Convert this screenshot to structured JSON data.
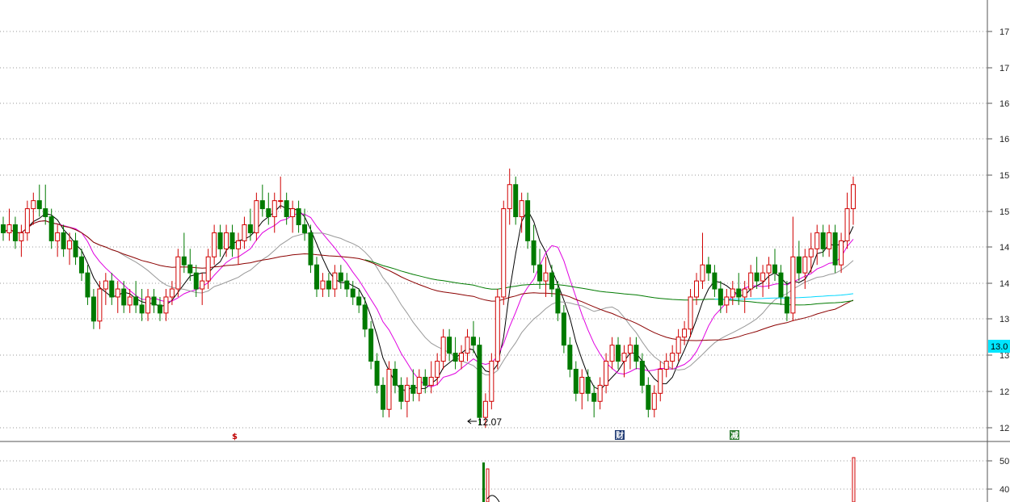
{
  "chart_data": {
    "type": "candlestick",
    "price_axis": {
      "tick_labels": [
        "17",
        "17",
        "16",
        "16",
        "15",
        "15",
        "14",
        "14",
        "13",
        "13",
        "12",
        "12"
      ],
      "ylim": [
        11.9,
        17.4
      ],
      "grid": "dotted horizontal"
    },
    "current_price_tag": "13.0",
    "low_annotation": "12.07",
    "volume_axis": {
      "tick_labels": [
        "50",
        "40"
      ]
    },
    "event_markers": [
      {
        "label": "$",
        "color": "#c00000"
      },
      {
        "label": "财",
        "color": "#1f3a73"
      },
      {
        "label": "减",
        "color": "#2e7d32"
      }
    ],
    "candles": [
      [
        14.6,
        14.7,
        14.4,
        14.5
      ],
      [
        14.5,
        14.8,
        14.4,
        14.6
      ],
      [
        14.6,
        14.7,
        14.3,
        14.4
      ],
      [
        14.4,
        14.6,
        14.2,
        14.5
      ],
      [
        14.5,
        14.9,
        14.4,
        14.8
      ],
      [
        14.8,
        15.0,
        14.6,
        14.9
      ],
      [
        14.9,
        15.1,
        14.7,
        14.8
      ],
      [
        14.8,
        15.1,
        14.6,
        14.7
      ],
      [
        14.7,
        14.8,
        14.3,
        14.4
      ],
      [
        14.4,
        14.6,
        14.2,
        14.5
      ],
      [
        14.5,
        14.6,
        14.2,
        14.3
      ],
      [
        14.3,
        14.5,
        14.1,
        14.4
      ],
      [
        14.4,
        14.5,
        14.1,
        14.2
      ],
      [
        14.2,
        14.3,
        13.9,
        14.0
      ],
      [
        14.0,
        14.1,
        13.6,
        13.7
      ],
      [
        13.7,
        13.8,
        13.3,
        13.4
      ],
      [
        13.4,
        13.9,
        13.3,
        13.8
      ],
      [
        13.8,
        14.0,
        13.6,
        13.9
      ],
      [
        13.9,
        14.0,
        13.6,
        13.7
      ],
      [
        13.7,
        13.9,
        13.5,
        13.8
      ],
      [
        13.8,
        13.9,
        13.5,
        13.6
      ],
      [
        13.6,
        13.8,
        13.5,
        13.7
      ],
      [
        13.7,
        13.9,
        13.5,
        13.6
      ],
      [
        13.6,
        13.8,
        13.4,
        13.5
      ],
      [
        13.5,
        13.8,
        13.4,
        13.7
      ],
      [
        13.7,
        13.8,
        13.5,
        13.6
      ],
      [
        13.6,
        13.7,
        13.4,
        13.5
      ],
      [
        13.5,
        13.8,
        13.4,
        13.7
      ],
      [
        13.7,
        13.9,
        13.6,
        13.8
      ],
      [
        13.8,
        14.3,
        13.7,
        14.2
      ],
      [
        14.2,
        14.5,
        14.0,
        14.1
      ],
      [
        14.1,
        14.3,
        13.9,
        14.0
      ],
      [
        14.0,
        14.1,
        13.7,
        13.8
      ],
      [
        13.8,
        14.0,
        13.6,
        13.9
      ],
      [
        13.9,
        14.3,
        13.8,
        14.2
      ],
      [
        14.2,
        14.6,
        14.1,
        14.5
      ],
      [
        14.5,
        14.6,
        14.2,
        14.3
      ],
      [
        14.3,
        14.6,
        14.2,
        14.5
      ],
      [
        14.5,
        14.6,
        14.2,
        14.3
      ],
      [
        14.3,
        14.5,
        14.1,
        14.4
      ],
      [
        14.4,
        14.7,
        14.3,
        14.6
      ],
      [
        14.6,
        14.8,
        14.4,
        14.5
      ],
      [
        14.5,
        15.0,
        14.4,
        14.9
      ],
      [
        14.9,
        15.1,
        14.7,
        14.8
      ],
      [
        14.8,
        15.0,
        14.6,
        14.7
      ],
      [
        14.7,
        15.0,
        14.5,
        14.9
      ],
      [
        14.9,
        15.2,
        14.8,
        14.9
      ],
      [
        14.9,
        15.0,
        14.6,
        14.7
      ],
      [
        14.7,
        14.9,
        14.5,
        14.8
      ],
      [
        14.8,
        14.9,
        14.5,
        14.6
      ],
      [
        14.6,
        14.8,
        14.4,
        14.5
      ],
      [
        14.5,
        14.6,
        14.0,
        14.1
      ],
      [
        14.1,
        14.2,
        13.7,
        13.8
      ],
      [
        13.8,
        14.0,
        13.7,
        13.9
      ],
      [
        13.9,
        14.0,
        13.7,
        13.8
      ],
      [
        13.8,
        14.1,
        13.7,
        14.0
      ],
      [
        14.0,
        14.1,
        13.8,
        13.9
      ],
      [
        13.9,
        14.0,
        13.7,
        13.8
      ],
      [
        13.8,
        13.9,
        13.6,
        13.7
      ],
      [
        13.7,
        13.8,
        13.5,
        13.6
      ],
      [
        13.6,
        13.7,
        13.2,
        13.3
      ],
      [
        13.3,
        13.4,
        12.8,
        12.9
      ],
      [
        12.9,
        13.0,
        12.5,
        12.6
      ],
      [
        12.6,
        12.7,
        12.2,
        12.3
      ],
      [
        12.3,
        12.9,
        12.2,
        12.8
      ],
      [
        12.8,
        12.9,
        12.5,
        12.6
      ],
      [
        12.6,
        12.7,
        12.3,
        12.4
      ],
      [
        12.4,
        12.7,
        12.2,
        12.6
      ],
      [
        12.6,
        12.8,
        12.4,
        12.5
      ],
      [
        12.5,
        12.8,
        12.4,
        12.7
      ],
      [
        12.7,
        12.8,
        12.5,
        12.6
      ],
      [
        12.6,
        12.9,
        12.5,
        12.7
      ],
      [
        12.7,
        13.0,
        12.6,
        12.9
      ],
      [
        12.9,
        13.3,
        12.8,
        13.2
      ],
      [
        13.2,
        13.3,
        12.9,
        13.0
      ],
      [
        13.0,
        13.2,
        12.8,
        12.9
      ],
      [
        12.9,
        13.1,
        12.8,
        13.0
      ],
      [
        13.0,
        13.3,
        12.9,
        13.2
      ],
      [
        13.2,
        13.4,
        13.0,
        13.1
      ],
      [
        13.1,
        13.2,
        12.1,
        12.2
      ],
      [
        12.2,
        12.5,
        12.07,
        12.4
      ],
      [
        12.4,
        13.0,
        12.3,
        12.9
      ],
      [
        12.9,
        13.8,
        12.8,
        13.7
      ],
      [
        13.7,
        14.9,
        13.6,
        14.8
      ],
      [
        14.8,
        15.3,
        14.6,
        15.1
      ],
      [
        15.1,
        15.2,
        14.6,
        14.7
      ],
      [
        14.7,
        15.0,
        14.5,
        14.9
      ],
      [
        14.9,
        15.0,
        14.3,
        14.4
      ],
      [
        14.4,
        14.6,
        14.0,
        14.1
      ],
      [
        14.1,
        14.3,
        13.8,
        13.9
      ],
      [
        13.9,
        14.2,
        13.7,
        14.0
      ],
      [
        14.0,
        14.1,
        13.7,
        13.8
      ],
      [
        13.8,
        13.9,
        13.4,
        13.5
      ],
      [
        13.5,
        13.6,
        13.0,
        13.1
      ],
      [
        13.1,
        13.2,
        12.7,
        12.8
      ],
      [
        12.8,
        12.9,
        12.4,
        12.5
      ],
      [
        12.5,
        12.8,
        12.3,
        12.7
      ],
      [
        12.7,
        12.8,
        12.4,
        12.5
      ],
      [
        12.5,
        12.6,
        12.2,
        12.4
      ],
      [
        12.4,
        12.7,
        12.3,
        12.6
      ],
      [
        12.6,
        13.0,
        12.5,
        12.9
      ],
      [
        12.9,
        13.2,
        12.8,
        13.1
      ],
      [
        13.1,
        13.2,
        12.8,
        12.9
      ],
      [
        12.9,
        13.1,
        12.7,
        13.0
      ],
      [
        13.0,
        13.2,
        12.8,
        13.1
      ],
      [
        13.1,
        13.2,
        12.8,
        12.9
      ],
      [
        12.9,
        13.0,
        12.5,
        12.6
      ],
      [
        12.6,
        12.7,
        12.2,
        12.3
      ],
      [
        12.3,
        12.6,
        12.2,
        12.5
      ],
      [
        12.5,
        12.9,
        12.4,
        12.8
      ],
      [
        12.8,
        13.0,
        12.7,
        12.9
      ],
      [
        12.9,
        13.1,
        12.8,
        13.0
      ],
      [
        13.0,
        13.3,
        12.9,
        13.2
      ],
      [
        13.2,
        13.4,
        13.1,
        13.3
      ],
      [
        13.3,
        13.8,
        13.2,
        13.7
      ],
      [
        13.7,
        14.0,
        13.6,
        13.9
      ],
      [
        13.9,
        14.5,
        13.8,
        14.1
      ],
      [
        14.1,
        14.2,
        13.9,
        14.0
      ],
      [
        14.0,
        14.1,
        13.7,
        13.8
      ],
      [
        13.8,
        13.9,
        13.5,
        13.6
      ],
      [
        13.6,
        13.8,
        13.5,
        13.7
      ],
      [
        13.7,
        13.9,
        13.6,
        13.8
      ],
      [
        13.8,
        14.0,
        13.6,
        13.7
      ],
      [
        13.7,
        13.9,
        13.5,
        13.8
      ],
      [
        13.8,
        14.1,
        13.7,
        14.0
      ],
      [
        14.0,
        14.2,
        13.8,
        13.9
      ],
      [
        13.9,
        14.1,
        13.7,
        14.0
      ],
      [
        14.0,
        14.2,
        13.8,
        14.1
      ],
      [
        14.1,
        14.3,
        13.9,
        14.0
      ],
      [
        14.0,
        14.1,
        13.6,
        13.7
      ],
      [
        13.7,
        13.9,
        13.4,
        13.5
      ],
      [
        13.5,
        14.7,
        13.4,
        14.2
      ],
      [
        14.2,
        14.4,
        13.9,
        14.0
      ],
      [
        14.0,
        14.3,
        13.8,
        14.2
      ],
      [
        14.2,
        14.5,
        14.0,
        14.3
      ],
      [
        14.3,
        14.6,
        14.1,
        14.5
      ],
      [
        14.5,
        14.6,
        14.2,
        14.3
      ],
      [
        14.3,
        14.6,
        14.2,
        14.5
      ],
      [
        14.5,
        14.6,
        14.0,
        14.1
      ],
      [
        14.1,
        14.5,
        14.0,
        14.4
      ],
      [
        14.4,
        15.0,
        14.3,
        14.8
      ],
      [
        14.8,
        15.2,
        14.6,
        15.1
      ]
    ]
  }
}
